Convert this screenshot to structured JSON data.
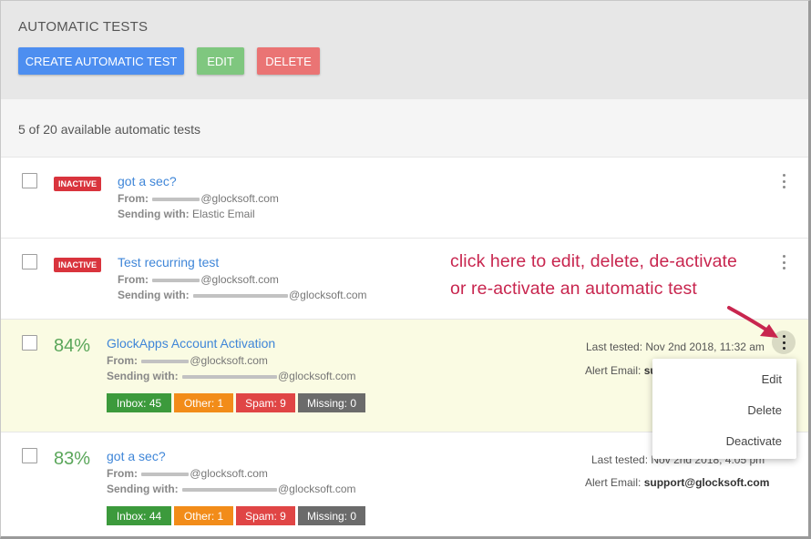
{
  "header": {
    "title": "AUTOMATIC TESTS",
    "buttons": {
      "create": "CREATE AUTOMATIC TEST",
      "edit": "EDIT",
      "delete": "DELETE"
    }
  },
  "summary": "5 of 20 available automatic tests",
  "labels": {
    "from": "From:",
    "sending_with": "Sending with:",
    "last_tested": "Last tested:",
    "alert_email": "Alert Email:"
  },
  "tests": [
    {
      "status": "INACTIVE",
      "subject": "got a sec?",
      "from_domain": "@glocksoft.com",
      "sending_with": "Elastic Email"
    },
    {
      "status": "INACTIVE",
      "subject": "Test recurring test",
      "from_domain": "@glocksoft.com",
      "sending_with_domain": "@glocksoft.com"
    },
    {
      "score": "84%",
      "subject": "GlockApps Account Activation",
      "from_domain": "@glocksoft.com",
      "sending_with_domain": "@glocksoft.com",
      "last_tested": "Nov 2nd 2018, 11:32 am",
      "alert_email": "su",
      "stats": {
        "inbox": "Inbox: 45",
        "other": "Other: 1",
        "spam": "Spam: 9",
        "missing": "Missing: 0"
      }
    },
    {
      "score": "83%",
      "subject": "got a sec?",
      "from_domain": "@glocksoft.com",
      "sending_with_domain": "@glocksoft.com",
      "last_tested": "Nov 2nd 2018, 4:05 pm",
      "alert_email": "support@glocksoft.com",
      "stats": {
        "inbox": "Inbox: 44",
        "other": "Other: 1",
        "spam": "Spam: 9",
        "missing": "Missing: 0"
      }
    }
  ],
  "menu": {
    "edit": "Edit",
    "delete": "Delete",
    "deactivate": "Deactivate"
  },
  "annotation": {
    "line1": "click here to edit, delete, de-activate",
    "line2": "or re-activate an automatic test"
  },
  "colors": {
    "primary": "#4d8ef0",
    "success": "#7fc77f",
    "danger": "#ea7474",
    "inactive_badge": "#d9343d",
    "score": "#5aa65a",
    "link": "#3f86d8",
    "annotation": "#c8264f",
    "highlight_row": "#fafbe3"
  }
}
